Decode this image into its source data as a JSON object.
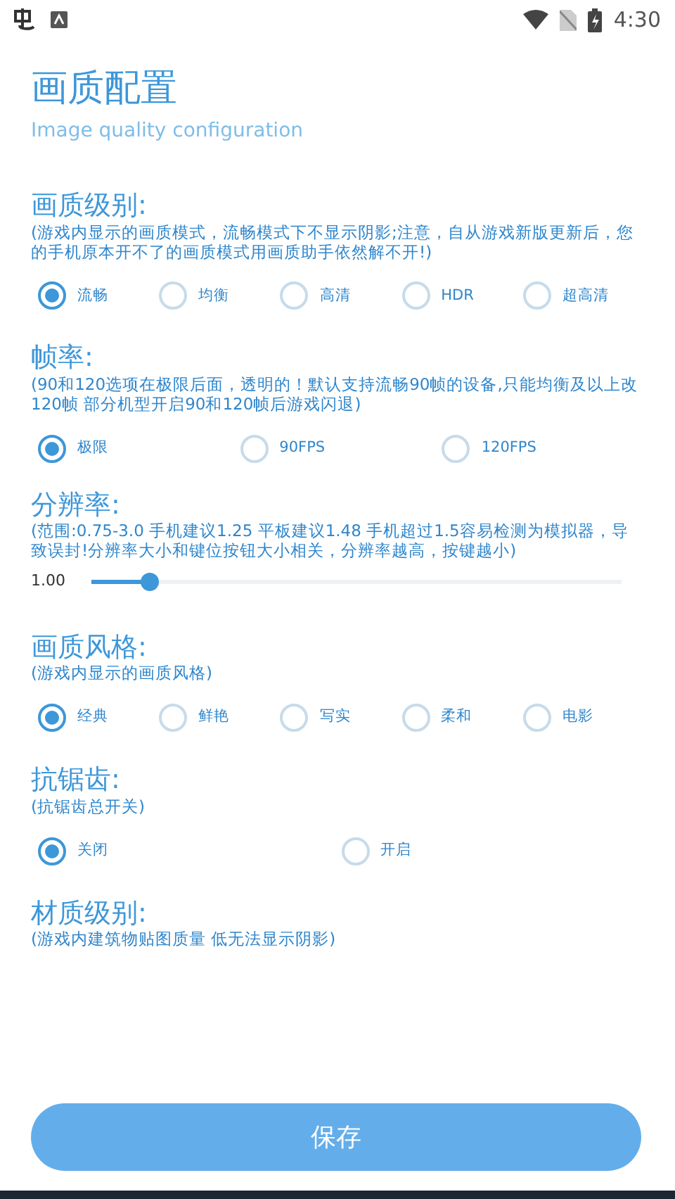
{
  "status_bar": {
    "time": "4:30"
  },
  "header": {
    "title": "画质配置",
    "subtitle": "Image quality configuration"
  },
  "sections": [
    {
      "kind": "radio",
      "title": "画质级别:",
      "description": "(游戏内显示的画质模式，流畅模式下不显示阴影;注意，自从游戏新版更新后，您的手机原本开不了的画质模式用画质助手依然解不开!)",
      "options": [
        {
          "label": "流畅",
          "selected": true
        },
        {
          "label": "均衡",
          "selected": false
        },
        {
          "label": "高清",
          "selected": false
        },
        {
          "label": "HDR",
          "selected": false
        },
        {
          "label": "超高清",
          "selected": false
        }
      ]
    },
    {
      "kind": "radio",
      "title": "帧率:",
      "description": "(90和120选项在极限后面，透明的！默认支持流畅90帧的设备,只能均衡及以上改120帧 部分机型开启90和120帧后游戏闪退)",
      "options": [
        {
          "label": "极限",
          "selected": true
        },
        {
          "label": "90FPS",
          "selected": false
        },
        {
          "label": "120FPS",
          "selected": false
        }
      ]
    },
    {
      "kind": "slider",
      "title": "分辨率:",
      "description": "(范围:0.75-3.0 手机建议1.25 平板建议1.48 手机超过1.5容易检测为模拟器，导致误封!分辨率大小和键位按钮大小相关，分辨率越高，按键越小)",
      "reading": "1.00",
      "level": 0.11
    },
    {
      "kind": "radio",
      "title": "画质风格:",
      "description": "(游戏内显示的画质风格)",
      "options": [
        {
          "label": "经典",
          "selected": true
        },
        {
          "label": "鲜艳",
          "selected": false
        },
        {
          "label": "写实",
          "selected": false
        },
        {
          "label": "柔和",
          "selected": false
        },
        {
          "label": "电影",
          "selected": false
        }
      ]
    },
    {
      "kind": "radio",
      "title": "抗锯齿:",
      "description": "(抗锯齿总开关)",
      "options": [
        {
          "label": "关闭",
          "selected": true
        },
        {
          "label": "开启",
          "selected": false
        }
      ]
    },
    {
      "kind": "text",
      "title": "材质级别:",
      "description": "(游戏内建筑物贴图质量 低无法显示阴影)"
    }
  ],
  "save_button": {
    "label": "保存"
  }
}
